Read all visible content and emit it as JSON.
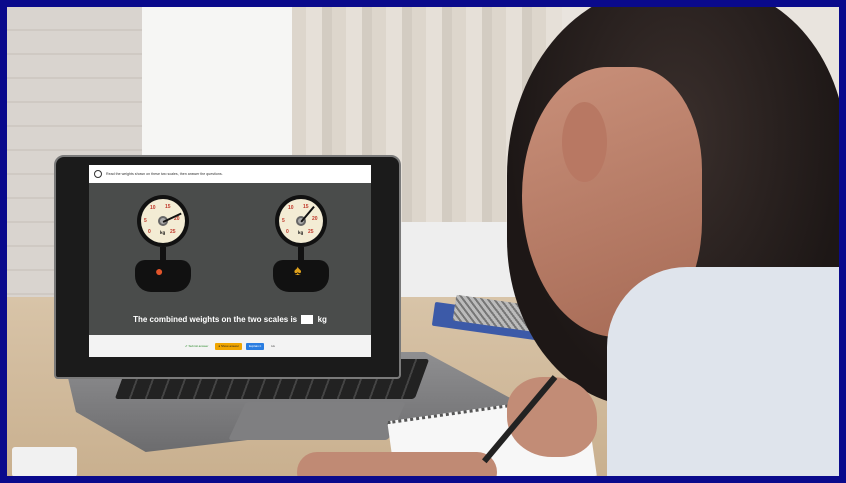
{
  "screen": {
    "prompt": "Read the weights shown on these two scales, then answer the questions.",
    "scale_ticks": [
      "0",
      "5",
      "10",
      "15",
      "20",
      "25"
    ],
    "unit_label": "kg",
    "question_before": "The combined weights on the two scales is",
    "question_unit": "kg",
    "buttons": {
      "submit": "✔ Submit answer",
      "show_answer": "● Show answer",
      "explain": "Explain it",
      "other": "Hs"
    },
    "fruit_left": "tomato-icon",
    "fruit_right": "pineapple-icon"
  },
  "colors": {
    "frame_border": "#0a0a8c",
    "screen_bg": "#4a4c4b",
    "tick_red": "#c0392b",
    "show_answer": "#f0a500",
    "explain": "#2a7de1"
  }
}
